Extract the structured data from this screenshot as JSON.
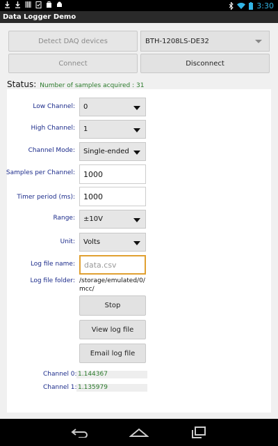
{
  "status_bar": {
    "time": "3:30"
  },
  "app": {
    "title": "Data Logger Demo"
  },
  "toolbar": {
    "detect_label": "Detect DAQ devices",
    "device_selected": "BTH-1208LS-DE32",
    "connect_label": "Connect",
    "disconnect_label": "Disconnect"
  },
  "status": {
    "label": "Status:",
    "text": "Number of samples acquired : 31"
  },
  "form": {
    "low_channel": {
      "label": "Low Channel:",
      "value": "0"
    },
    "high_channel": {
      "label": "High Channel:",
      "value": "1"
    },
    "channel_mode": {
      "label": "Channel Mode:",
      "value": "Single-ended"
    },
    "samples_per_channel": {
      "label": "Samples per Channel:",
      "value": "1000"
    },
    "timer_period": {
      "label": "Timer period (ms):",
      "value": "1000"
    },
    "range": {
      "label": "Range:",
      "value": "±10V"
    },
    "unit": {
      "label": "Unit:",
      "value": "Volts"
    },
    "log_file_name": {
      "label": "Log file name:",
      "placeholder": "data.csv"
    },
    "log_file_folder": {
      "label": "Log file folder:",
      "value": "/storage/emulated/0/\nmcc/"
    }
  },
  "actions": {
    "stop_label": "Stop",
    "view_log_label": "View log file",
    "email_log_label": "Email log file"
  },
  "channels": [
    {
      "label": "Channel 0:",
      "value": "1.144367"
    },
    {
      "label": "Channel 1:",
      "value": "1.135979"
    }
  ],
  "colors": {
    "status_green": "#2a7a2a",
    "label_blue": "#1a2a8a",
    "focus_orange": "#e0a030",
    "clock_blue": "#33b5e5"
  }
}
